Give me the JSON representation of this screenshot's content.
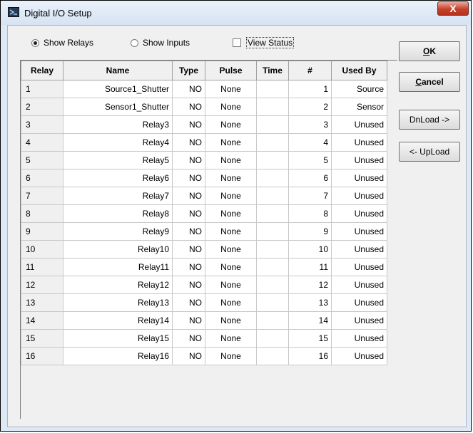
{
  "window": {
    "title": "Digital I/O Setup",
    "close_label": "X"
  },
  "options": {
    "show_relays": {
      "label": "Show Relays",
      "selected": true
    },
    "show_inputs": {
      "label": "Show Inputs",
      "selected": false
    },
    "view_status": {
      "label": "View Status",
      "checked": false
    }
  },
  "table": {
    "columns": [
      "Relay",
      "Name",
      "Type",
      "Pulse",
      "Time",
      "#",
      "Used By"
    ],
    "rows": [
      [
        "1",
        "Source1_Shutter",
        "NO",
        "None",
        "",
        "1",
        "Source"
      ],
      [
        "2",
        "Sensor1_Shutter",
        "NO",
        "None",
        "",
        "2",
        "Sensor"
      ],
      [
        "3",
        "Relay3",
        "NO",
        "None",
        "",
        "3",
        "Unused"
      ],
      [
        "4",
        "Relay4",
        "NO",
        "None",
        "",
        "4",
        "Unused"
      ],
      [
        "5",
        "Relay5",
        "NO",
        "None",
        "",
        "5",
        "Unused"
      ],
      [
        "6",
        "Relay6",
        "NO",
        "None",
        "",
        "6",
        "Unused"
      ],
      [
        "7",
        "Relay7",
        "NO",
        "None",
        "",
        "7",
        "Unused"
      ],
      [
        "8",
        "Relay8",
        "NO",
        "None",
        "",
        "8",
        "Unused"
      ],
      [
        "9",
        "Relay9",
        "NO",
        "None",
        "",
        "9",
        "Unused"
      ],
      [
        "10",
        "Relay10",
        "NO",
        "None",
        "",
        "10",
        "Unused"
      ],
      [
        "11",
        "Relay11",
        "NO",
        "None",
        "",
        "11",
        "Unused"
      ],
      [
        "12",
        "Relay12",
        "NO",
        "None",
        "",
        "12",
        "Unused"
      ],
      [
        "13",
        "Relay13",
        "NO",
        "None",
        "",
        "13",
        "Unused"
      ],
      [
        "14",
        "Relay14",
        "NO",
        "None",
        "",
        "14",
        "Unused"
      ],
      [
        "15",
        "Relay15",
        "NO",
        "None",
        "",
        "15",
        "Unused"
      ],
      [
        "16",
        "Relay16",
        "NO",
        "None",
        "",
        "16",
        "Unused"
      ]
    ]
  },
  "buttons": {
    "ok_first": "O",
    "ok_rest": "K",
    "cancel_first": "C",
    "cancel_rest": "ancel",
    "download": "DnLoad ->",
    "upload": "<- UpLoad"
  },
  "icons": {
    "app": "digital-io-app-icon",
    "close": "close-icon"
  }
}
